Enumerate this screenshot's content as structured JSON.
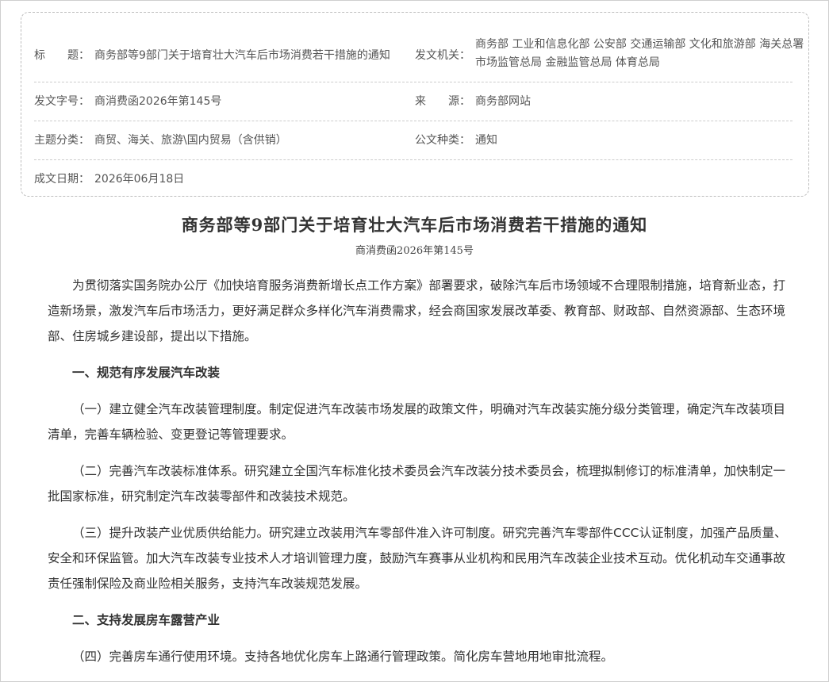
{
  "meta": {
    "title_label": "标　　题：",
    "title_value": "商务部等9部门关于培育壮大汽车后市场消费若干措施的通知",
    "issuer_label": "发文机关：",
    "issuer_value": "商务部 工业和信息化部 公安部 交通运输部 文化和旅游部 海关总署 市场监管总局 金融监管总局 体育总局",
    "docno_label": "发文字号：",
    "docno_value": "商消费函2026年第145号",
    "source_label": "来　　源：",
    "source_value": "商务部网站",
    "subject_label": "主题分类：",
    "subject_value": "商贸、海关、旅游\\国内贸易（含供销）",
    "type_label": "公文种类：",
    "type_value": "通知",
    "date_label": "成文日期：",
    "date_value": "2026年06月18日"
  },
  "doc": {
    "title": "商务部等9部门关于培育壮大汽车后市场消费若干措施的通知",
    "number": "商消费函2026年第145号",
    "paragraphs": [
      "为贯彻落实国务院办公厅《加快培育服务消费新增长点工作方案》部署要求，破除汽车后市场领域不合理限制措施，培育新业态，打造新场景，激发汽车后市场活力，更好满足群众多样化汽车消费需求，经会商国家发展改革委、教育部、财政部、自然资源部、生态环境部、住房城乡建设部，提出以下措施。",
      "一、规范有序发展汽车改装",
      "（一）建立健全汽车改装管理制度。制定促进汽车改装市场发展的政策文件，明确对汽车改装实施分级分类管理，确定汽车改装项目清单，完善车辆检验、变更登记等管理要求。",
      "（二）完善汽车改装标准体系。研究建立全国汽车标准化技术委员会汽车改装分技术委员会，梳理拟制修订的标准清单，加快制定一批国家标准，研究制定汽车改装零部件和改装技术规范。",
      "（三）提升改装产业优质供给能力。研究建立改装用汽车零部件准入许可制度。研究完善汽车零部件CCC认证制度，加强产品质量、安全和环保监管。加大汽车改装专业技术人才培训管理力度，鼓励汽车赛事从业机构和民用汽车改装企业技术互动。优化机动车交通事故责任强制保险及商业险相关服务，支持汽车改装规范发展。",
      "二、支持发展房车露营产业",
      "（四）完善房车通行使用环境。支持各地优化房车上路通行管理政策。简化房车营地用地审批流程。"
    ]
  }
}
